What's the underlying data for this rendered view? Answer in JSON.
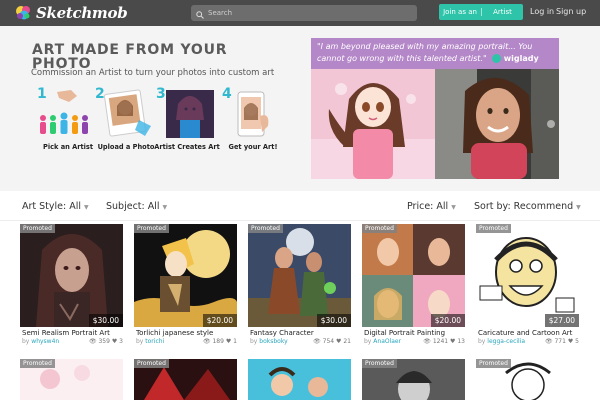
{
  "brand": {
    "name": "Sketchmob"
  },
  "header": {
    "search_placeholder": "Search",
    "join_label": "Join as an",
    "artist_label": "Artist",
    "login": "Log in",
    "signup": "Sign up"
  },
  "hero": {
    "title": "ART MADE FROM YOUR PHOTO",
    "subtitle": "Commission an Artist to turn your photos into custom art",
    "steps": [
      {
        "num": "1",
        "label": "Pick an Artist"
      },
      {
        "num": "2",
        "label": "Upload a Photo"
      },
      {
        "num": "3",
        "label": "Artist Creates Art"
      },
      {
        "num": "4",
        "label": "Get your Art!"
      }
    ],
    "quote": "\"I am beyond pleased with my amazing portrait... You cannot go wrong with this talented artist.\"",
    "quote_user": "wiglady"
  },
  "filters": {
    "style": "Art Style: All",
    "subject": "Subject: All",
    "price": "Price: All",
    "sort": "Sort by: Recommend"
  },
  "promoted_label": "Promoted",
  "by_label": "by",
  "listings": [
    {
      "title": "Semi Realism Portrait Art",
      "artist": "whysw4n",
      "price": "$30.00",
      "views": "359",
      "likes": "3"
    },
    {
      "title": "Torlichi japanese style",
      "artist": "torichi",
      "price": "$20.00",
      "views": "189",
      "likes": "1"
    },
    {
      "title": "Fantasy Character",
      "artist": "boksboky",
      "price": "$30.00",
      "views": "754",
      "likes": "21"
    },
    {
      "title": "Digital Portrait Painting",
      "artist": "AnaOlaer",
      "price": "$20.00",
      "views": "1241",
      "likes": "13"
    },
    {
      "title": "Caricature and Cartoon Art",
      "artist": "legga-cecilia",
      "price": "$27.00",
      "views": "771",
      "likes": "5"
    }
  ],
  "colors": {
    "topbar": "#4a4a4a",
    "accent": "#2ec4a9",
    "link": "#29a6bd",
    "quote_bg": "#b487c8",
    "hero_bg": "#f4f4f4"
  }
}
